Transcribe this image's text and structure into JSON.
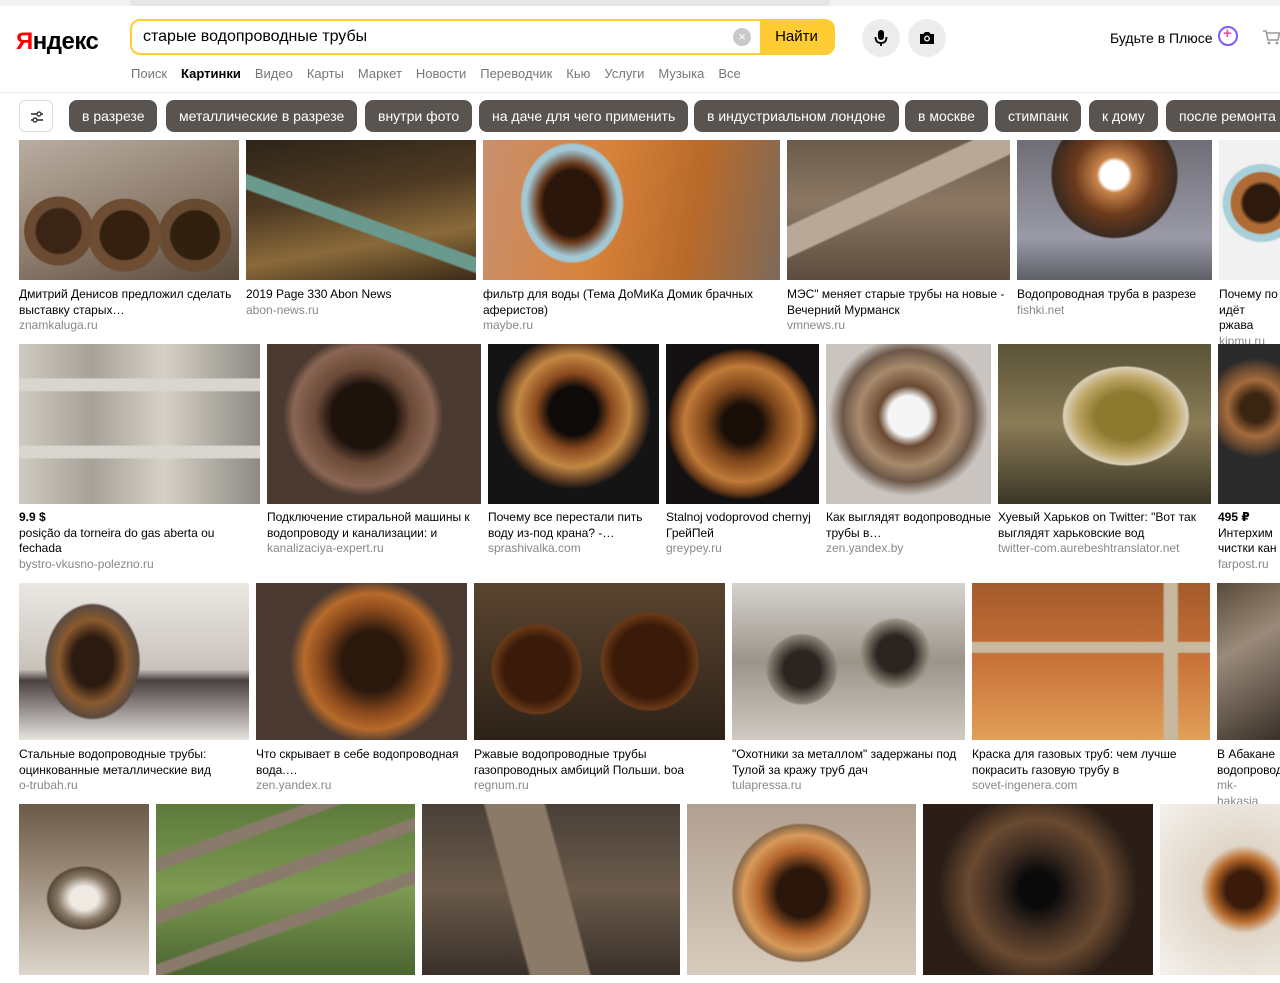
{
  "logo": {
    "first": "Я",
    "rest": "ндекс"
  },
  "search": {
    "value": "старые водопроводные трубы",
    "clear": "×",
    "button": "Найти"
  },
  "plus": {
    "label": "Будьте в Плюсе"
  },
  "services": [
    "Поиск",
    "Картинки",
    "Видео",
    "Карты",
    "Маркет",
    "Новости",
    "Переводчик",
    "Кью",
    "Услуги",
    "Музыка",
    "Все"
  ],
  "chips": [
    "в разрезе",
    "металлические в разрезе",
    "внутри фото",
    "на даче для чего применить",
    "в индустриальном лондоне",
    "в москве",
    "стимпанк",
    "к дому",
    "после ремонта"
  ],
  "results": [
    {
      "title": "Дмитрий Денисов предложил сделать выставку старых…",
      "source": "znamkaluga.ru"
    },
    {
      "title": "2019 Page 330 Abon News",
      "source": "abon-news.ru"
    },
    {
      "title": "фильтр для воды (Тема ДоМиКа Домик брачных аферистов)",
      "source": "maybe.ru"
    },
    {
      "title": "МЭС\" меняет старые трубы на новые - Вечерний Мурманск",
      "source": "vmnews.ru"
    },
    {
      "title": "Водопроводная труба в разрезе",
      "source": "fishki.net"
    },
    {
      "title": "Почему по идёт ржава",
      "source": "kipmu.ru"
    },
    {
      "price": "9.9 $",
      "title": "posição da torneira do gas aberta ou fechada",
      "source": "bystro-vkusno-polezno.ru"
    },
    {
      "title": "Подключение стиральной машины к водопроводу и канализации: и",
      "source": "kanalizaciya-expert.ru"
    },
    {
      "title": "Почему все перестали пить воду из-под крана? -…",
      "source": "sprashivalka.com"
    },
    {
      "title": "Stalnoj vodoprovod chernyj ГрейПей",
      "source": "greypey.ru"
    },
    {
      "title": "Как выглядят водопроводные трубы в…",
      "source": "zen.yandex.by"
    },
    {
      "title": "Хуевый Харьков on Twitter: \"Вот так выглядят харьковские вод",
      "source": "twitter-com.aurebeshtranslator.net"
    },
    {
      "price": "495 ₽",
      "title": "Интерхим чистки кан",
      "source": "farpost.ru"
    },
    {
      "title": "Стальные водопроводные трубы: оцинкованные металлические вид",
      "source": "o-trubah.ru"
    },
    {
      "title": "Что скрывает в себе водопроводная вода.…",
      "source": "zen.yandex.ru"
    },
    {
      "title": "Ржавые водопроводные трубы газопроводных амбиций Польши. boa",
      "source": "regnum.ru"
    },
    {
      "title": "\"Охотники за металлом\" задержаны под Тулой за кражу труб дач",
      "source": "tulapressa.ru"
    },
    {
      "title": "Краска для газовых труб: чем лучше покрасить газовую трубу в",
      "source": "sovet-ingenera.com"
    },
    {
      "title": "В Абакане водопровод",
      "source": "mk-hakasia."
    },
    {
      "title": "",
      "source": ""
    },
    {
      "title": "",
      "source": ""
    },
    {
      "title": "",
      "source": ""
    },
    {
      "title": "",
      "source": ""
    },
    {
      "title": "",
      "source": ""
    },
    {
      "title": "",
      "source": ""
    }
  ],
  "colors": {
    "accent": "#ffcc33",
    "chip": "#5a5450",
    "logo_red": "#ff0000"
  }
}
